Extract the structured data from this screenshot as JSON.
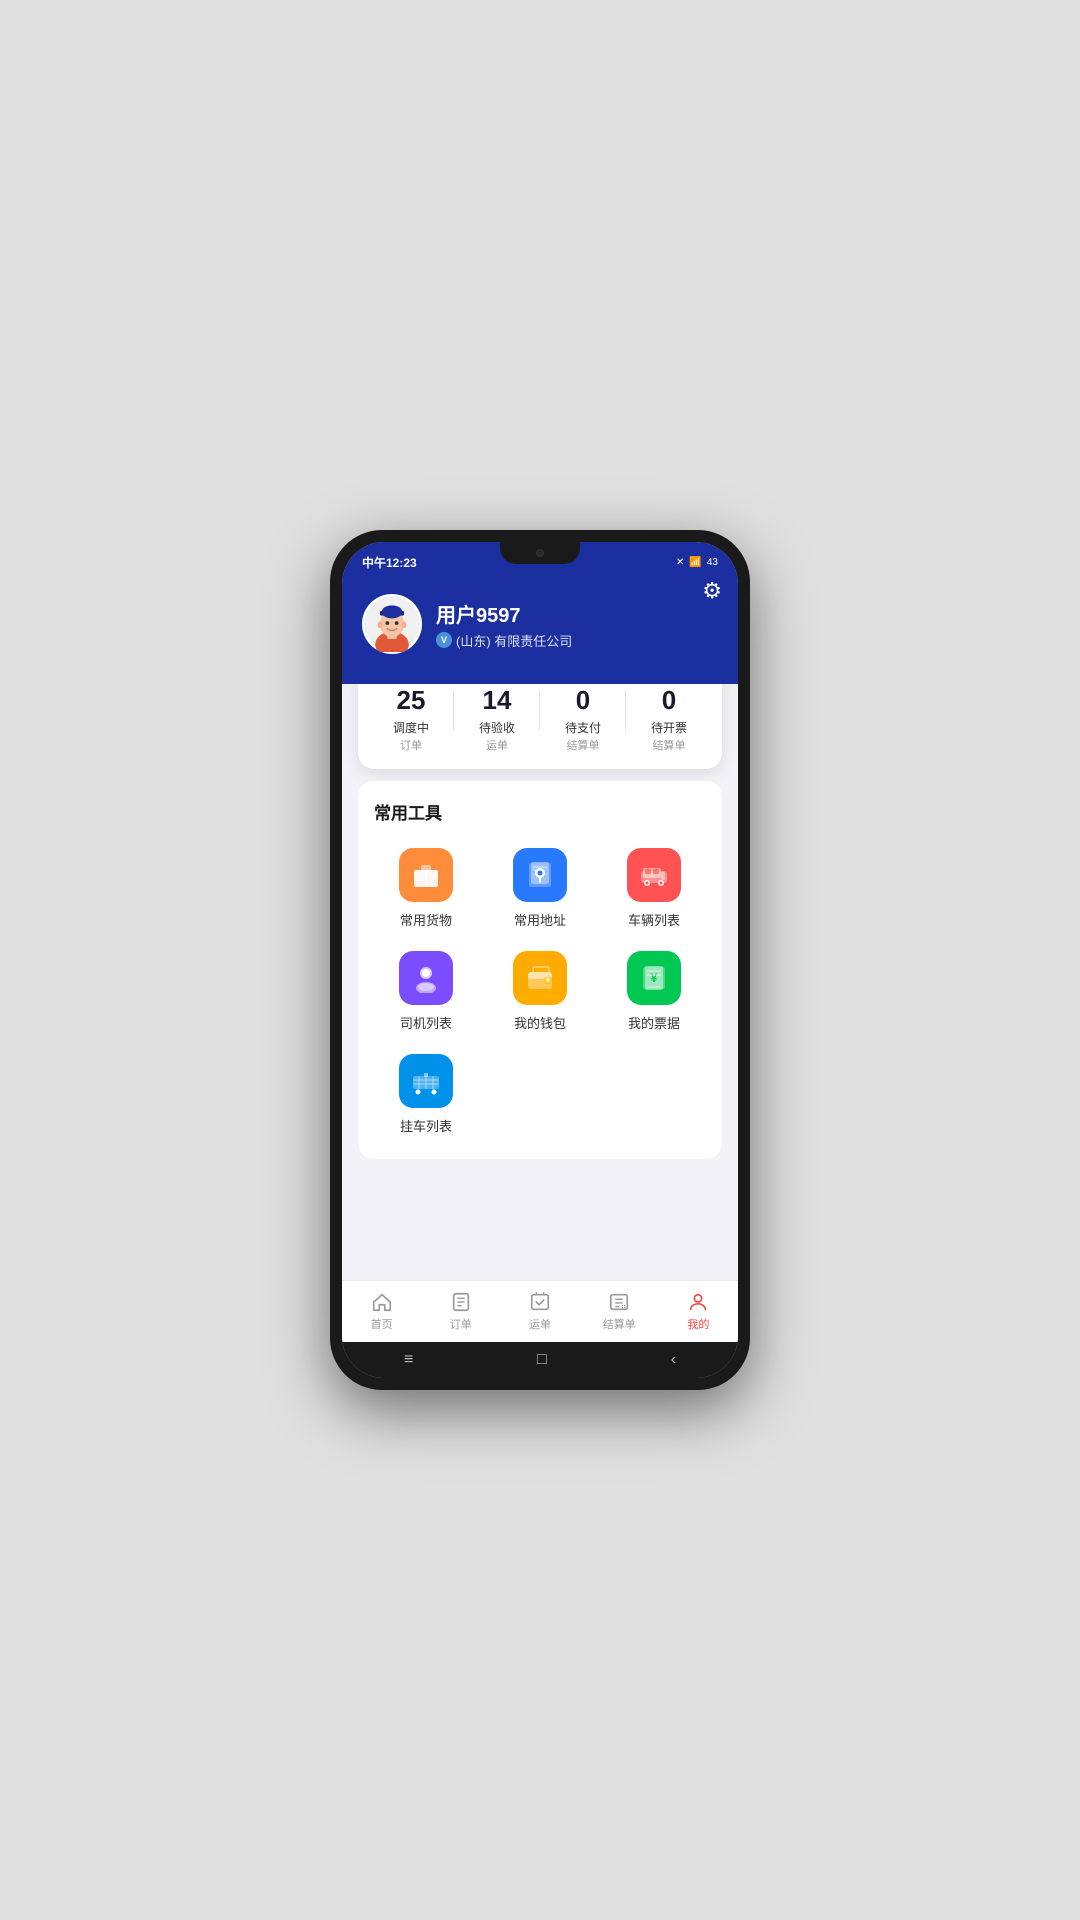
{
  "statusBar": {
    "time": "中午12:23",
    "batteryLevel": "43"
  },
  "header": {
    "settingsLabel": "⚙",
    "username": "用户9597",
    "verifiedBadge": "V",
    "company": "(山东) 有限责任公司"
  },
  "stats": [
    {
      "number": "25",
      "label1": "调度中",
      "label2": "订单"
    },
    {
      "number": "14",
      "label1": "待验收",
      "label2": "运单"
    },
    {
      "number": "0",
      "label1": "待支付",
      "label2": "结算单"
    },
    {
      "number": "0",
      "label1": "待开票",
      "label2": "结算单"
    }
  ],
  "tools": {
    "sectionTitle": "常用工具",
    "items": [
      {
        "label": "常用货物",
        "colorClass": "orange",
        "icon": "📦"
      },
      {
        "label": "常用地址",
        "colorClass": "blue",
        "icon": "📍"
      },
      {
        "label": "车辆列表",
        "colorClass": "red",
        "icon": "🚌"
      },
      {
        "label": "司机列表",
        "colorClass": "purple",
        "icon": "👤"
      },
      {
        "label": "我的钱包",
        "colorClass": "yellow",
        "icon": "👛"
      },
      {
        "label": "我的票据",
        "colorClass": "green",
        "icon": "🎫"
      },
      {
        "label": "挂车列表",
        "colorClass": "lightblue",
        "icon": "🚛"
      }
    ]
  },
  "bottomNav": [
    {
      "label": "首页",
      "icon": "⊞",
      "active": false
    },
    {
      "label": "订单",
      "icon": "☰",
      "active": false
    },
    {
      "label": "运单",
      "icon": "⟳",
      "active": false
    },
    {
      "label": "结算单",
      "icon": "⊟",
      "active": false
    },
    {
      "label": "我的",
      "icon": "👤",
      "active": true
    }
  ],
  "androidNav": {
    "menu": "≡",
    "home": "□",
    "back": "‹"
  }
}
